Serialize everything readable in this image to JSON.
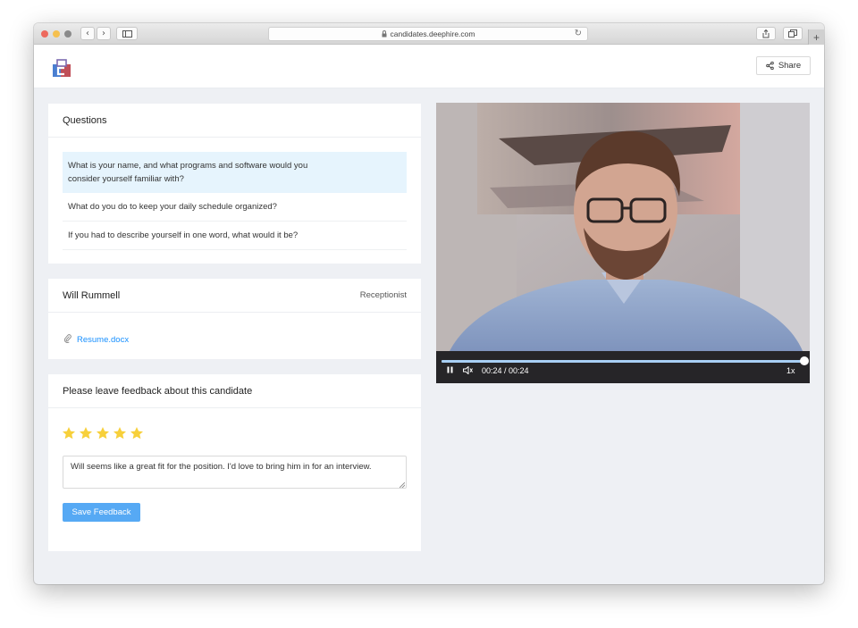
{
  "browser": {
    "url": "candidates.deephire.com"
  },
  "header": {
    "share_label": "Share"
  },
  "questions": {
    "title": "Questions",
    "items": [
      "What is your name, and what programs and software would you consider yourself familiar with?",
      "What do you do to keep your daily schedule organized?",
      "If you had to describe yourself in one word, what would it be?"
    ],
    "active_index": 0
  },
  "candidate": {
    "name": "Will Rummell",
    "role": "Receptionist",
    "attachment": "Resume.docx"
  },
  "feedback": {
    "title": "Please leave feedback about this candidate",
    "rating": 5,
    "rating_max": 5,
    "comment": "Will seems like a great fit for the position. I'd love to bring him in for an interview.",
    "save_label": "Save Feedback"
  },
  "video": {
    "time_label": "00:24 / 00:24",
    "progress": 1.0,
    "speed_label": "1x"
  },
  "colors": {
    "accent": "#1890ff",
    "button": "#56a9f4",
    "star": "#f7d03b",
    "active_question_bg": "#e6f4fd"
  }
}
